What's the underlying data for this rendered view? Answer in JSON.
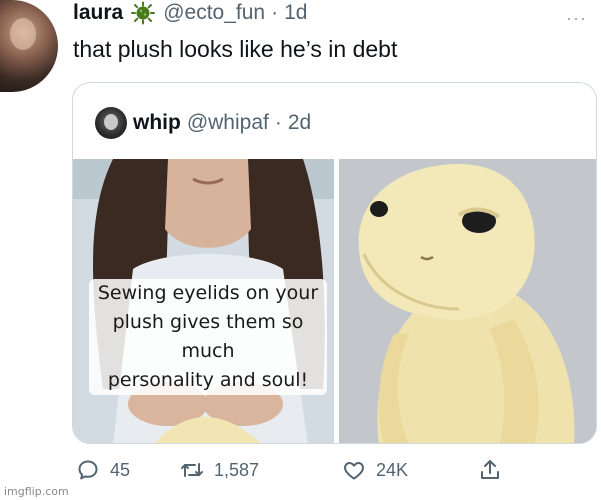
{
  "tweet": {
    "display_name": "laura",
    "badge_icon": "virus-emoji-icon",
    "handle": "@ecto_fun",
    "separator": "·",
    "time": "1d",
    "more": "···",
    "text": "that plush looks like he’s in debt"
  },
  "quote": {
    "display_name": "whip",
    "handle": "@whipaf",
    "separator": "·",
    "time": "2d",
    "caption_lines": [
      "Sewing eyelids on your",
      "plush gives them so much",
      "personality and soul!"
    ]
  },
  "actions": {
    "reply_count": "45",
    "retweet_count": "1,587",
    "like_count": "24K"
  },
  "watermark": "imgflip.com",
  "colors": {
    "text": "#0f1419",
    "muted": "#536471",
    "border": "#cfd9de",
    "badge": "#4a7a1e",
    "plush": "#f1e6b3"
  }
}
